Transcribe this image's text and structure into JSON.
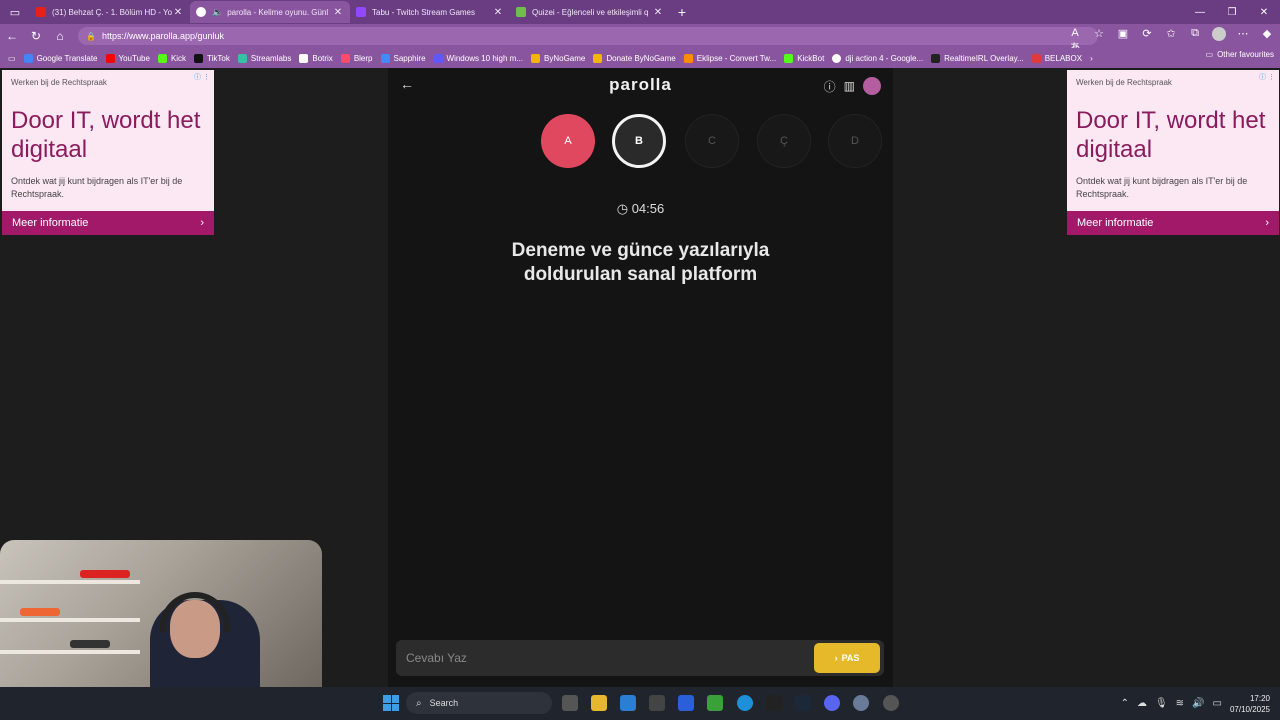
{
  "browser": {
    "tabs": [
      {
        "title": "(31) Behzat Ç. - 1. Bölüm HD - Yo",
        "color": "#e62117",
        "active": false
      },
      {
        "title": "parolla - Kelime oyunu. Günl",
        "color": "#ffffff",
        "active": true
      },
      {
        "title": "Tabu - Twitch Stream Games",
        "color": "#9146ff",
        "active": false
      },
      {
        "title": "Quizei - Eğlenceli ve etkileşimli q",
        "color": "#6ec04b",
        "active": false
      }
    ],
    "url": "https://www.parolla.app/gunluk",
    "bookmarks": [
      {
        "label": "Google Translate",
        "color": "#4285f4"
      },
      {
        "label": "YouTube",
        "color": "#ff0000"
      },
      {
        "label": "Kick",
        "color": "#53fc18"
      },
      {
        "label": "TikTok",
        "color": "#111111"
      },
      {
        "label": "Streamlabs",
        "color": "#31c3a2"
      },
      {
        "label": "Botrix",
        "color": "#ffffff"
      },
      {
        "label": "Blerp",
        "color": "#ff4b6b"
      },
      {
        "label": "Sapphire",
        "color": "#3d8bfd"
      },
      {
        "label": "Windows 10 high m...",
        "color": "#5a5aff"
      },
      {
        "label": "ByNoGame",
        "color": "#f2b705"
      },
      {
        "label": "Donate ByNoGame",
        "color": "#f2b705"
      },
      {
        "label": "Eklipse - Convert Tw...",
        "color": "#ff8c00"
      },
      {
        "label": "KickBot",
        "color": "#53fc18"
      },
      {
        "label": "dji action 4 - Google...",
        "color": "#ffffff"
      },
      {
        "label": "RealtimeIRL Overlay...",
        "color": "#222222"
      },
      {
        "label": "BELABOX",
        "color": "#e03b3b"
      }
    ],
    "other_favourites": "Other favourites"
  },
  "ad": {
    "source": "Werken bij de Rechtspraak",
    "headline": "Door IT, wordt het digitaal",
    "body": "Ontdek wat jij kunt bijdragen als IT'er bij de Rechtspraak.",
    "cta": "Meer informatie"
  },
  "app": {
    "logo": "parolla",
    "letters": [
      {
        "label": "A",
        "state": "done"
      },
      {
        "label": "B",
        "state": "current"
      },
      {
        "label": "C",
        "state": "todo"
      },
      {
        "label": "Ç",
        "state": "todo"
      },
      {
        "label": "D",
        "state": "todo"
      }
    ],
    "timer": "04:56",
    "clue": "Deneme ve günce yazılarıyla doldurulan sanal platform",
    "input_placeholder": "Cevabı Yaz",
    "pas_label": "PAS"
  },
  "taskbar": {
    "search_label": "Search",
    "time": "17:20",
    "date": "07/10/2025"
  }
}
